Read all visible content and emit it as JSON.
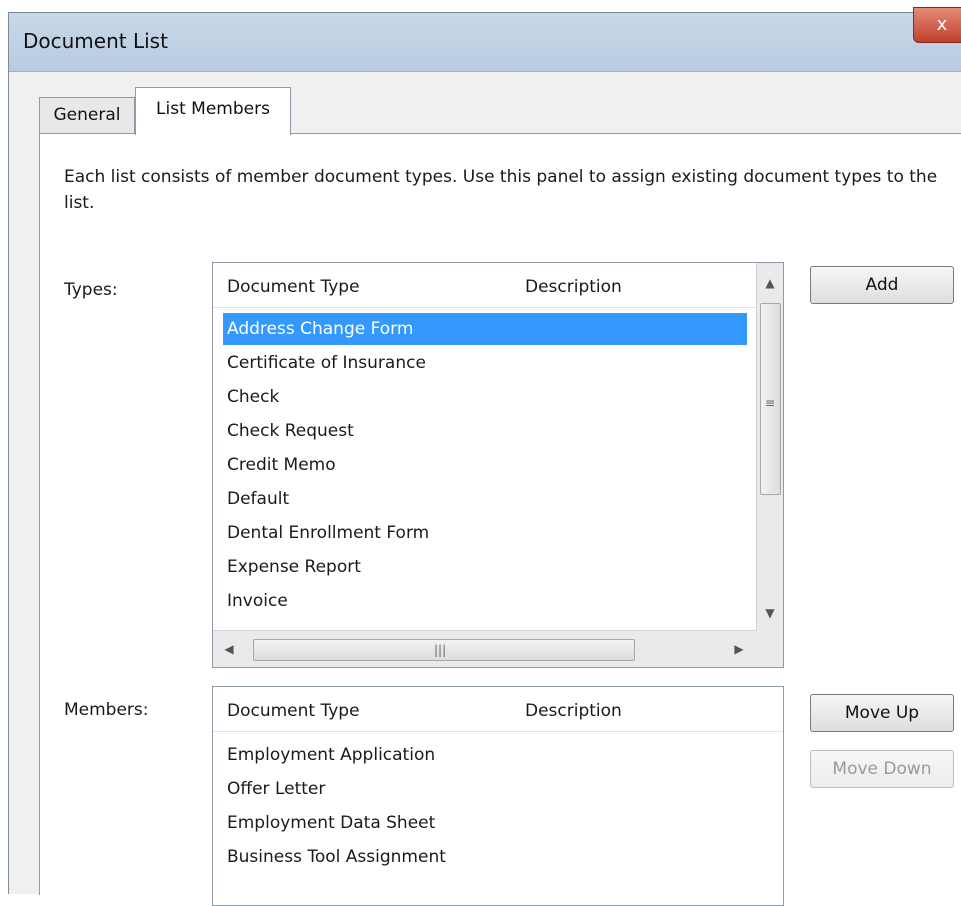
{
  "window": {
    "title": "Document List",
    "close_glyph": "x"
  },
  "tabs": [
    {
      "label": "General",
      "active": false
    },
    {
      "label": "List Members",
      "active": true
    }
  ],
  "intro_text": "Each list consists of member document types.  Use this panel to assign existing document types to the list.",
  "types": {
    "label": "Types:",
    "columns": [
      "Document Type",
      "Description"
    ],
    "rows": [
      "Address Change Form",
      "Certificate of Insurance",
      "Check",
      "Check Request",
      "Credit Memo",
      "Default",
      "Dental Enrollment Form",
      "Expense Report",
      "Invoice"
    ],
    "selected_index": 0,
    "add_button": "Add"
  },
  "members": {
    "label": "Members:",
    "columns": [
      "Document Type",
      "Description"
    ],
    "rows": [
      "Employment Application",
      "Offer Letter",
      "Employment Data Sheet",
      "Business Tool Assignment"
    ],
    "move_up_button": "Move Up",
    "move_down_button": "Move Down",
    "move_down_enabled": false
  },
  "icons": {
    "scroll_up": "up-arrow-icon",
    "scroll_down": "down-arrow-icon",
    "scroll_left": "left-arrow-icon",
    "scroll_right": "right-arrow-icon"
  },
  "colors": {
    "selection": "#3399ff",
    "accent_close": "#c0412c"
  }
}
